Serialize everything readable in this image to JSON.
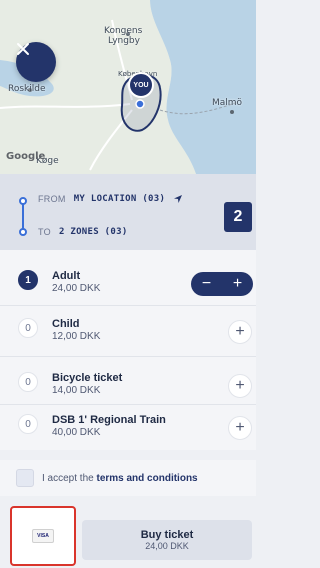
{
  "map": {
    "labels": {
      "kongens": "Kongens",
      "lyngby": "Lyngby",
      "roskilde": "Roskilde",
      "malmo": "Malmö",
      "kobenhavn": "København",
      "koge": "Køge"
    },
    "you_label": "YOU",
    "attribution": "Google"
  },
  "route": {
    "from_label": "FROM",
    "from_value": "MY LOCATION (03)",
    "to_label": "TO",
    "to_value": "2 ZONES (03)",
    "zone_count": "2"
  },
  "tickets": [
    {
      "qty": "1",
      "name": "Adult",
      "price": "24,00 DKK"
    },
    {
      "qty": "0",
      "name": "Child",
      "price": "12,00 DKK"
    },
    {
      "qty": "0",
      "name": "Bicycle ticket",
      "price": "14,00 DKK"
    },
    {
      "qty": "0",
      "name": "DSB 1' Regional Train",
      "price": "40,00 DKK"
    }
  ],
  "stepper": {
    "minus": "−",
    "plus": "+"
  },
  "terms": {
    "prefix": "I accept the ",
    "link": "terms and conditions"
  },
  "payment": {
    "card": "VISA"
  },
  "buy": {
    "label": "Buy ticket",
    "price": "24,00 DKK"
  },
  "colors": {
    "primary": "#23346a",
    "accent": "#3a6fd8",
    "highlight": "#d9342b"
  }
}
